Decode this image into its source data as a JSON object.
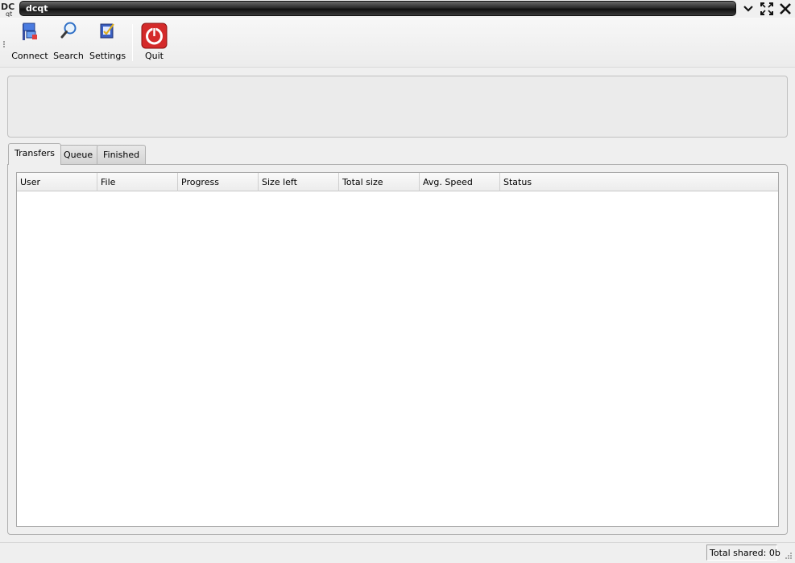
{
  "window": {
    "title": "dcqt",
    "logo_text": "DC",
    "logo_subtext": "qt"
  },
  "toolbar": {
    "items": [
      {
        "label": "Connect",
        "icon": "connect-icon"
      },
      {
        "label": "Search",
        "icon": "magnifier-icon"
      },
      {
        "label": "Settings",
        "icon": "settings-icon"
      },
      {
        "label": "Quit",
        "icon": "power-icon"
      }
    ]
  },
  "tabs": [
    {
      "label": "Transfers",
      "active": true
    },
    {
      "label": "Queue",
      "active": false
    },
    {
      "label": "Finished",
      "active": false
    }
  ],
  "transfers_table": {
    "columns": [
      "User",
      "File",
      "Progress",
      "Size left",
      "Total size",
      "Avg. Speed",
      "Status"
    ],
    "rows": []
  },
  "statusbar": {
    "total_shared": "Total shared: 0b"
  },
  "colors": {
    "quit_red": "#d42a2a",
    "title_bar_dark": "#1a1a1a"
  }
}
